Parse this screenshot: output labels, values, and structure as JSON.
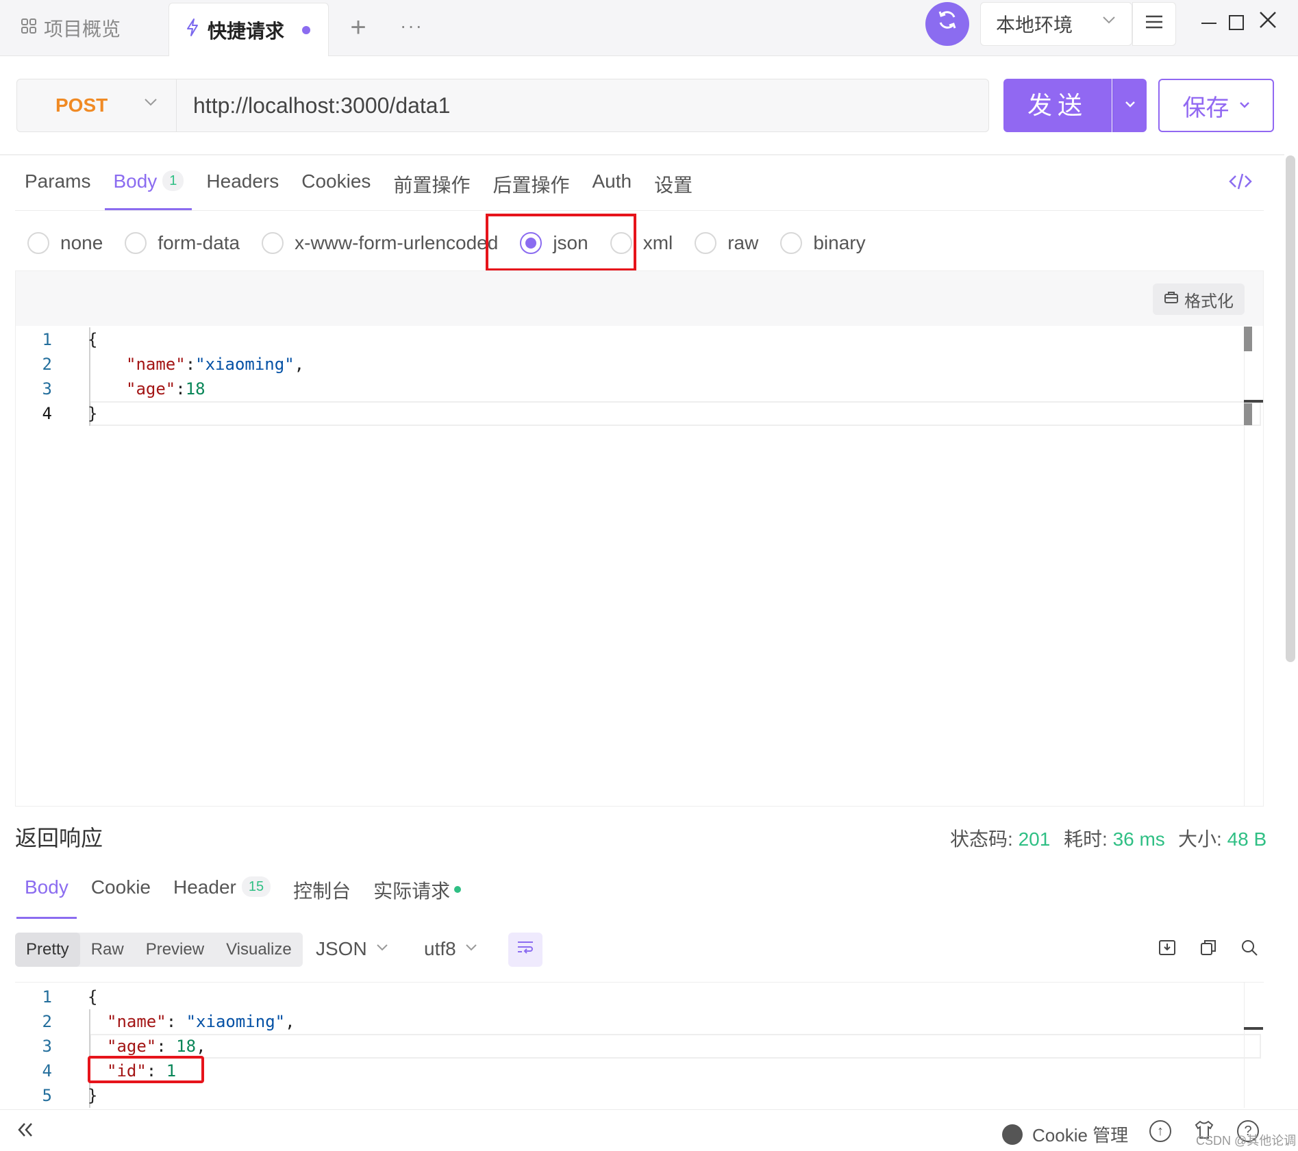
{
  "top_tabs": {
    "overview_label": "项目概览",
    "active_label": "快捷请求",
    "add_symbol": "+",
    "more_symbol": "···"
  },
  "environment": {
    "selected": "本地环境"
  },
  "request": {
    "method": "POST",
    "url": "http://localhost:3000/data1",
    "send_label": "发送",
    "save_label": "保存"
  },
  "request_tabs": [
    {
      "label": "Params"
    },
    {
      "label": "Body",
      "badge": "1",
      "active": true
    },
    {
      "label": "Headers"
    },
    {
      "label": "Cookies"
    },
    {
      "label": "前置操作"
    },
    {
      "label": "后置操作"
    },
    {
      "label": "Auth"
    },
    {
      "label": "设置"
    }
  ],
  "body_types": [
    {
      "label": "none"
    },
    {
      "label": "form-data"
    },
    {
      "label": "x-www-form-urlencoded"
    },
    {
      "label": "json",
      "checked": true
    },
    {
      "label": "xml"
    },
    {
      "label": "raw"
    },
    {
      "label": "binary"
    }
  ],
  "format_label": "格式化",
  "request_body_lines": [
    {
      "n": "1",
      "text": "{"
    },
    {
      "n": "2",
      "key": "\"name\"",
      "sep": ":",
      "value": "\"xiaoming\"",
      "tail": ","
    },
    {
      "n": "3",
      "key": "\"age\"",
      "sep": ":",
      "value": "18",
      "tail": ""
    },
    {
      "n": "4",
      "text": "}"
    }
  ],
  "response": {
    "title": "返回响应",
    "status_label": "状态码:",
    "status_value": "201",
    "time_label": "耗时:",
    "time_value": "36 ms",
    "size_label": "大小:",
    "size_value": "48 B",
    "tabs": [
      {
        "label": "Body",
        "active": true
      },
      {
        "label": "Cookie"
      },
      {
        "label": "Header",
        "badge": "15"
      },
      {
        "label": "控制台"
      },
      {
        "label": "实际请求",
        "dot": true
      }
    ],
    "view_modes": [
      "Pretty",
      "Raw",
      "Preview",
      "Visualize"
    ],
    "active_view": "Pretty",
    "format": "JSON",
    "encoding": "utf8",
    "body_lines": [
      {
        "n": "1",
        "text": "{"
      },
      {
        "n": "2",
        "key": "\"name\"",
        "sep": ": ",
        "value": "\"xiaoming\"",
        "tail": ","
      },
      {
        "n": "3",
        "key": "\"age\"",
        "sep": ": ",
        "value": "18",
        "tail": ","
      },
      {
        "n": "4",
        "key": "\"id\"",
        "sep": ": ",
        "value": "1",
        "tail": ""
      },
      {
        "n": "5",
        "text": "}"
      }
    ]
  },
  "statusbar": {
    "cookie_manager": "Cookie 管理",
    "watermark": "CSDN @其他论调"
  },
  "colors": {
    "accent": "#8b6cf0",
    "method_post": "#f08a24",
    "success": "#2fbf84",
    "highlight_box": "#e6141b"
  }
}
